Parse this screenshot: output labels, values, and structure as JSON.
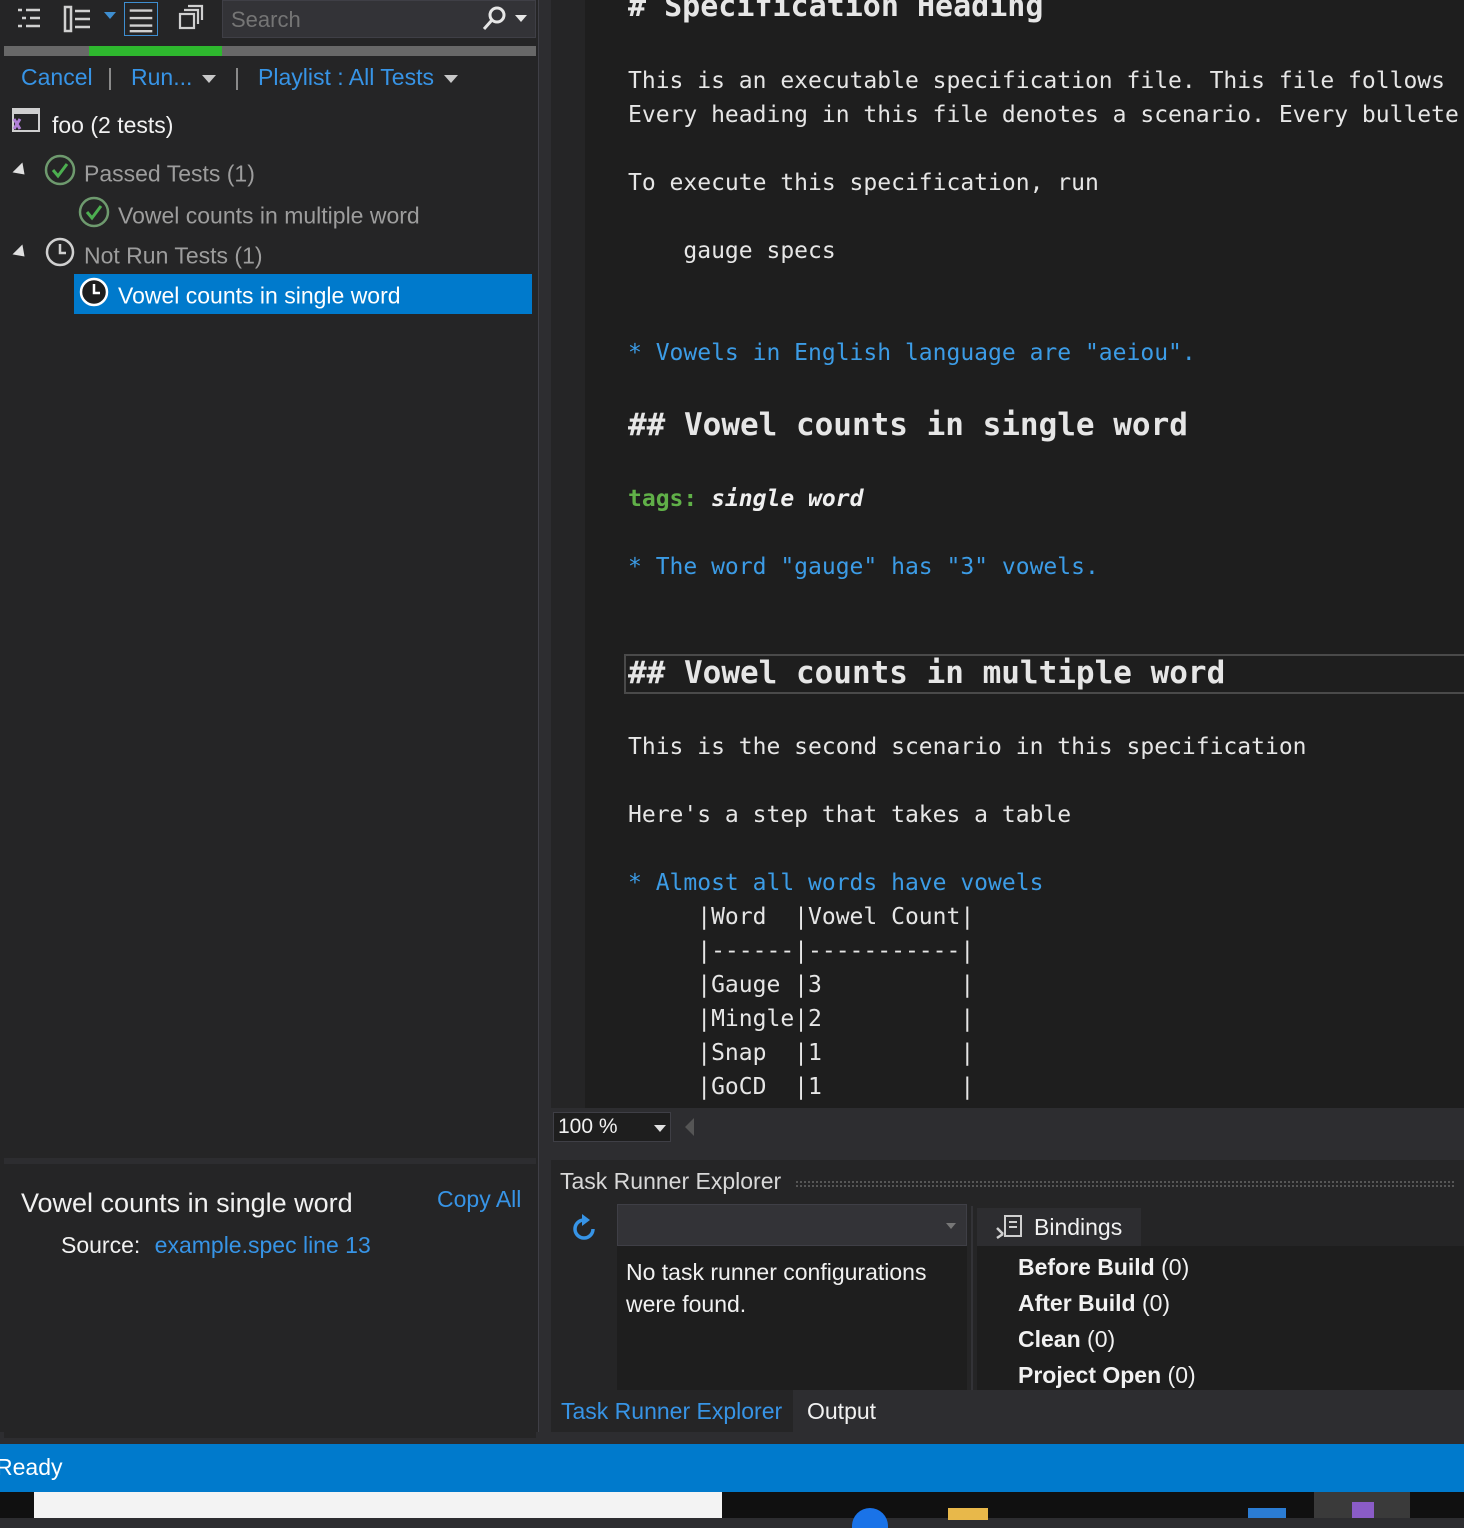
{
  "test_explorer": {
    "search_placeholder": "Search",
    "progress_fraction": 0.25,
    "commands": {
      "cancel": "Cancel",
      "run": "Run...",
      "playlist": "Playlist : All Tests"
    },
    "project": "foo (2 tests)",
    "groups": [
      {
        "label": "Passed Tests (1)",
        "items": [
          "Vowel counts in multiple word"
        ]
      },
      {
        "label": "Not Run Tests (1)",
        "items": [
          "Vowel counts in single word"
        ]
      }
    ],
    "detail": {
      "title": "Vowel counts in single word",
      "copy_all": "Copy All",
      "source_label": "Source:",
      "source_link": "example.spec line 13"
    }
  },
  "editor": {
    "lines": {
      "h1": "# Specification Heading",
      "p1": "This is an executable specification file. This file follows",
      "p2": "Every heading in this file denotes a scenario. Every bullete",
      "p3": "To execute this specification, run",
      "p4": "    gauge specs",
      "step1": "* Vowels in English language are \"aeiou\".",
      "h2a": "## Vowel counts in single word",
      "tags_label": "tags:",
      "tags_value": "single word",
      "step2": "* The word \"gauge\" has \"3\" vowels.",
      "h2b": "## Vowel counts in multiple word",
      "p5": "This is the second scenario in this specification",
      "p6": "Here's a step that takes a table",
      "step3": "* Almost all words have vowels"
    },
    "table_rows": [
      "     |Word  |Vowel Count|",
      "     |------|-----------|",
      "     |Gauge |3          |",
      "     |Mingle|2          |",
      "     |Snap  |1          |",
      "     |GoCD  |1          |"
    ],
    "zoom": "100 %"
  },
  "task_runner": {
    "title": "Task Runner Explorer",
    "empty_message_1": "No task runner configurations",
    "empty_message_2": "were found.",
    "bindings_tab": "Bindings",
    "bindings": [
      {
        "name": "Before Build",
        "count": "(0)"
      },
      {
        "name": "After Build",
        "count": "(0)"
      },
      {
        "name": "Clean",
        "count": "(0)"
      },
      {
        "name": "Project Open",
        "count": "(0)"
      }
    ],
    "tabs": [
      "Task Runner Explorer",
      "Output"
    ]
  },
  "status": {
    "text": "Ready"
  },
  "colors": {
    "accent": "#007acc",
    "passed": "#2eb82e",
    "link": "#3794e6"
  }
}
